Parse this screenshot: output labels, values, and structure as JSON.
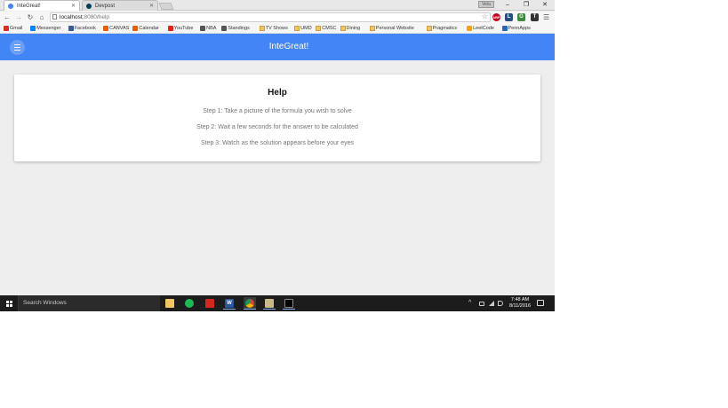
{
  "browser": {
    "tabs": [
      {
        "title": "InteGreat!",
        "active": true,
        "favicon_color": "#4285f4"
      },
      {
        "title": "Devpost",
        "active": false,
        "favicon_color": "#003e54"
      }
    ],
    "profile_label": "Vela",
    "url": {
      "host": "localhost",
      "path": ":8080/help"
    },
    "extensions": {
      "abp": "ABP",
      "l": "L",
      "g": "G",
      "t": "T"
    },
    "bookmarks": [
      {
        "label": "Gmail",
        "icon": "gmail-icon",
        "color": "#d93025"
      },
      {
        "label": "Messenger",
        "icon": "messenger-icon",
        "color": "#0084ff"
      },
      {
        "label": "Facebook",
        "icon": "facebook-icon",
        "color": "#3b5998"
      },
      {
        "label": "CANVAS",
        "icon": "canvas-icon",
        "color": "#e66000"
      },
      {
        "label": "Calendar",
        "icon": "calendar-icon",
        "color": "#e66000"
      },
      {
        "label": "YouTube",
        "icon": "youtube-icon",
        "color": "#e62117"
      },
      {
        "label": "NBA",
        "icon": "nba-icon",
        "color": "#555555"
      },
      {
        "label": "Standings",
        "icon": "standings-icon",
        "color": "#555555"
      },
      {
        "label": "TV Shows",
        "icon": "folder-icon",
        "folder": true
      },
      {
        "label": "UMD",
        "icon": "folder-icon",
        "folder": true
      },
      {
        "label": "CMSC",
        "icon": "folder-icon",
        "folder": true
      },
      {
        "label": "Dining",
        "icon": "folder-icon",
        "folder": true
      },
      {
        "label": "Personal Website",
        "icon": "folder-icon",
        "folder": true
      },
      {
        "label": "Pragmatics",
        "icon": "folder-icon",
        "folder": true
      },
      {
        "label": "LeetCode",
        "icon": "leetcode-icon",
        "color": "#f89f1b"
      },
      {
        "label": "PennApps",
        "icon": "pennapps-icon",
        "color": "#2a66c9"
      }
    ]
  },
  "app": {
    "title": "InteGreat!",
    "accent": "#4285f4"
  },
  "help": {
    "title": "Help",
    "steps": [
      "Step 1: Take a picture of the formula you wish to solve",
      "Step 2: Wait a few seconds for the answer to be calculated",
      "Step 3: Watch as the solution appears before your eyes"
    ]
  },
  "taskbar": {
    "search_placeholder": "Search Windows",
    "apps": [
      {
        "name": "file-explorer",
        "glyph": "",
        "color": "#f0c75e"
      },
      {
        "name": "spotify",
        "glyph": "",
        "color": "#1db954"
      },
      {
        "name": "acrobat",
        "glyph": "",
        "color": "#d7261e"
      },
      {
        "name": "word",
        "glyph": "W",
        "color": "#2b579a"
      },
      {
        "name": "chrome",
        "glyph": "",
        "color": "#db4437"
      },
      {
        "name": "this-pc",
        "glyph": "",
        "color": "#c9b88a"
      },
      {
        "name": "command-prompt",
        "glyph": "",
        "color": "#000000"
      }
    ],
    "time": "7:48 AM",
    "date": "8/11/2016"
  }
}
